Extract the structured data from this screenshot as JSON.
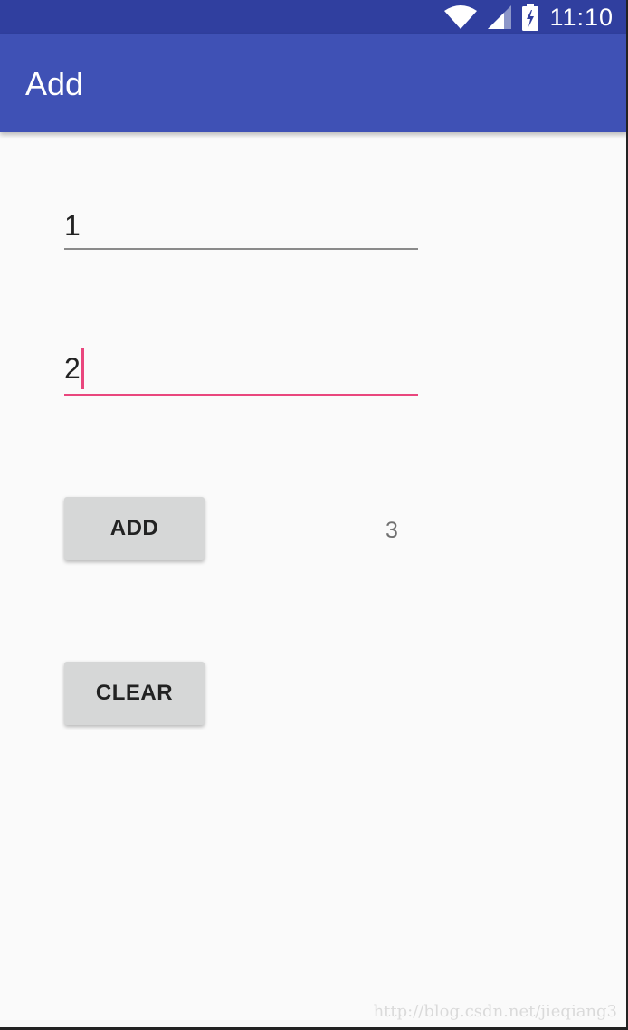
{
  "status_bar": {
    "time": "11:10",
    "icons": [
      "wifi-icon",
      "signal-icon",
      "battery-charging-icon"
    ],
    "color": "#303f9f"
  },
  "app_bar": {
    "title": "Add",
    "color": "#3f51b5"
  },
  "form": {
    "first_number": "1",
    "second_number": "2",
    "focused_field_accent": "#e9467d"
  },
  "buttons": {
    "add_label": "ADD",
    "clear_label": "CLEAR"
  },
  "result": {
    "value": "3"
  },
  "watermark": "http://blog.csdn.net/jieqiang3"
}
